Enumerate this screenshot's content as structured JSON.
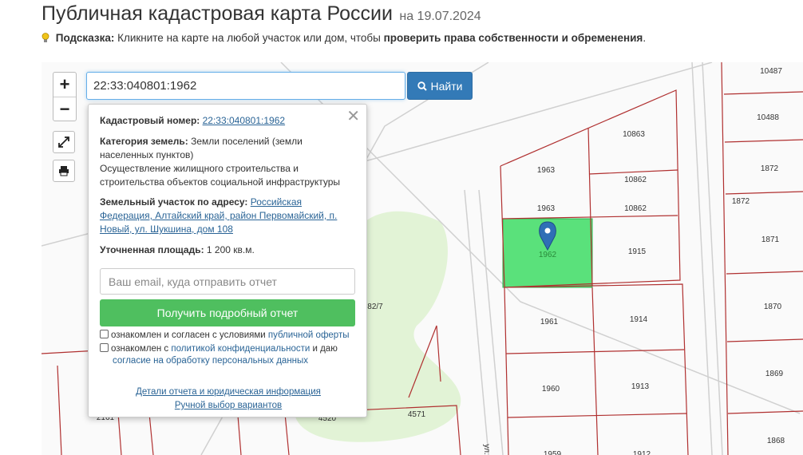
{
  "header": {
    "title": "Публичная кадастровая карта России",
    "date": "на 19.07.2024"
  },
  "hint": {
    "label": "Подсказка:",
    "text": " Кликните на карте на любой участок или дом, чтобы ",
    "emphasis": "проверить права собственности и обременения",
    "end": "."
  },
  "toolbar": {
    "zoom_in": "+",
    "zoom_out": "−",
    "search_value": "22:33:040801:1962",
    "find_label": "Найти"
  },
  "popup": {
    "close": "✕",
    "cadastral_label": "Кадастровый номер:",
    "cadastral_value": "22:33:040801:1962",
    "category_label": "Категория земель:",
    "category_value": " Земли поселений (земли населенных пунктов)",
    "usage": "Осуществление жилищного строительства и строительства объектов социальной инфраструктуры",
    "address_label": "Земельный участок по адресу:",
    "address_value": "Российская Федерация, Алтайский край, район Первомайский, п. Новый, ул. Шукшина, дом 108",
    "area_label": "Уточненная площадь:",
    "area_value": " 1 200 кв.м.",
    "email_placeholder": "Ваш email, куда отправить отчет",
    "report_button": "Получить подробный отчет",
    "consent1_text": "ознакомлен и согласен с условиями ",
    "consent1_link": "публичной оферты",
    "consent2_text": "ознакомлен с ",
    "consent2_link": "политикой конфиденциальности",
    "consent2_tail": " и даю",
    "consent2_link2": "согласие на обработку персональных данных",
    "details_link": "Детали отчета и юридическая информация",
    "manual_link": "Ручной выбор вариантов"
  },
  "map": {
    "selected_color": "#3ddc64",
    "parcel_line_color": "#b03030",
    "road_color": "#d0d0d0",
    "green_area_color": "#e2f3d6",
    "labels": {
      "p10487": "10487",
      "p10488": "10488",
      "p10863": "10863",
      "p10862a": "10862",
      "p10862b": "10862",
      "p1963a": "1963",
      "p1963b": "1963",
      "p1872a": "1872",
      "p1872b": "1872",
      "p1871": "1871",
      "p1962": "1962",
      "p1915": "1915",
      "p1961": "1961",
      "p1914": "1914",
      "p1870": "1870",
      "p1960": "1960",
      "p1913": "1913",
      "p1869": "1869",
      "p1868": "1868",
      "p1959": "1959",
      "p1912": "1912",
      "p4571": "4571",
      "p4520": "4520",
      "p2161": "2161",
      "p827": "82/7",
      "street": "ул."
    }
  }
}
